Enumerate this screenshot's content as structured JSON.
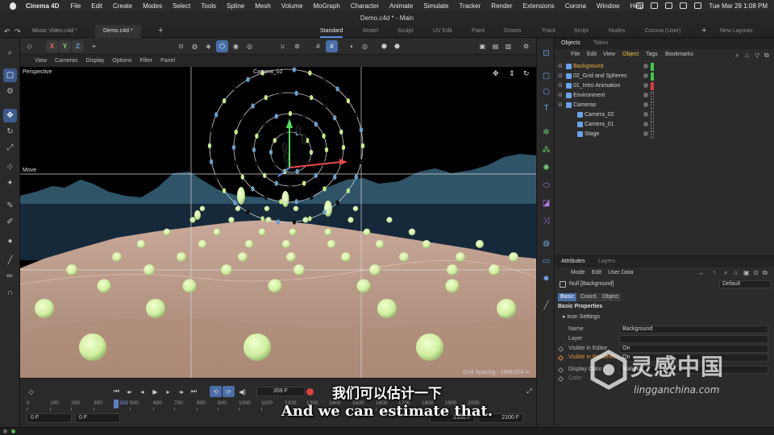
{
  "menubar": {
    "app_name": "Cinema 4D",
    "items": [
      "File",
      "Edit",
      "Create",
      "Modes",
      "Select",
      "Tools",
      "Spline",
      "Mesh",
      "Volume",
      "MoGraph",
      "Character",
      "Animate",
      "Simulate",
      "Tracker",
      "Render",
      "Extensions",
      "Corona",
      "Window",
      "Help"
    ],
    "clock": "Tue Mar 29  1:08 PM"
  },
  "window": {
    "title": "Demo.c4d * - Main"
  },
  "tabs": {
    "documents": [
      {
        "label": "Music Video.c4d *",
        "active": false
      },
      {
        "label": "Demo.c4d *",
        "active": true
      }
    ],
    "layouts": [
      "Standard",
      "Model",
      "Sculpt",
      "UV Edit",
      "Paint",
      "Groom",
      "Track",
      "Script",
      "Nodes",
      "Corona (User)"
    ],
    "active_layout": "Standard",
    "new_layouts": "New Layouts"
  },
  "toolbar": {
    "axis_x": "X",
    "axis_y": "Y",
    "axis_z": "Z"
  },
  "viewport": {
    "menu": [
      "View",
      "Cameras",
      "Display",
      "Options",
      "Filter",
      "Panel"
    ],
    "view_name": "Perspective",
    "camera_label": "Camera_02",
    "tool_label": "Move",
    "grid_spacing": "Grid Spacing : 1968.504 in",
    "colors": {
      "sky": "#000000",
      "mountains": "#2f5468",
      "sea": "#16293a",
      "sand": "#b89886",
      "spheres": "#d8f3a0"
    }
  },
  "timeline": {
    "current_frame": "359 F",
    "start_field": "0 F",
    "start_field2": "0 F",
    "end_field": "2100 F",
    "end_field2": "2100 F",
    "playhead_label": "359",
    "ruler_labels": [
      "0",
      "100",
      "200",
      "300",
      "500",
      "600",
      "700",
      "800",
      "900",
      "1000",
      "1100",
      "1200",
      "1300",
      "1400",
      "1500",
      "1600",
      "1700",
      "1800",
      "1900",
      "2000"
    ]
  },
  "objects": {
    "panel_tabs": [
      "Objects",
      "Takes"
    ],
    "menu": [
      "File",
      "Edit",
      "View",
      "Object",
      "Tags",
      "Bookmarks"
    ],
    "active_menu": "Object",
    "items": [
      {
        "name": "Background",
        "indent": 0,
        "highlight": true,
        "tag": "green"
      },
      {
        "name": "02_Grid and Spheres",
        "indent": 0,
        "highlight": false,
        "tag": "green"
      },
      {
        "name": "01_Intro Animation",
        "indent": 0,
        "highlight": false,
        "tag": "red"
      },
      {
        "name": "Environment",
        "indent": 0,
        "highlight": false,
        "tag": ""
      },
      {
        "name": "Cameras",
        "indent": 0,
        "highlight": false,
        "tag": ""
      },
      {
        "name": "Camera_02",
        "indent": 1,
        "highlight": false,
        "tag": ""
      },
      {
        "name": "Camera_01",
        "indent": 1,
        "highlight": false,
        "tag": ""
      },
      {
        "name": "Stage",
        "indent": 1,
        "highlight": false,
        "tag": ""
      }
    ]
  },
  "attributes": {
    "panel_tabs": [
      "Attributes",
      "Layers"
    ],
    "menu": [
      "Mode",
      "Edit",
      "User Data"
    ],
    "object_title": "Null [Background]",
    "preset": "Default",
    "subtabs": [
      "Basic",
      "Coord.",
      "Object"
    ],
    "active_subtab": "Basic",
    "section": "Basic Properties",
    "subsection": "Icon Settings",
    "rows": [
      {
        "label": "Name",
        "value": "Background"
      },
      {
        "label": "Layer",
        "value": ""
      },
      {
        "label": "Visible in Editor",
        "value": "On"
      },
      {
        "label": "Visible in Renderer",
        "value": "On"
      },
      {
        "label": "Display Color",
        "value": "Material"
      },
      {
        "label": "Color",
        "value": ""
      }
    ]
  },
  "subtitles": {
    "chinese": "我们可以估计一下",
    "english": "And we can estimate that."
  },
  "watermark": {
    "chinese": "灵感中国",
    "english": "lingganchina.com"
  }
}
